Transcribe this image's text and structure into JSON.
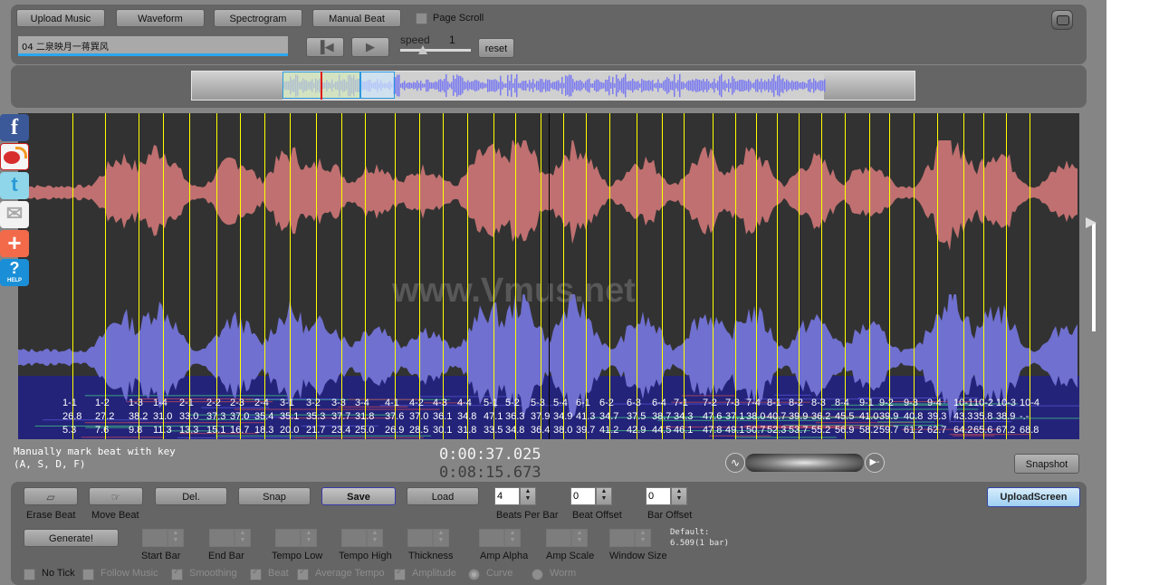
{
  "toolbar": {
    "upload_music": "Upload Music",
    "waveform": "Waveform",
    "spectrogram": "Spectrogram",
    "manual_beat": "Manual Beat",
    "page_scroll": "Page Scroll",
    "page_scroll_checked": false,
    "track_name": "04 二泉映月一蒋巽风",
    "speed_label": "speed",
    "speed_value": "1",
    "reset": "reset"
  },
  "overview": {
    "waveform_color": "#7b7bf0",
    "selection_color": "#d6f0b8",
    "view_color": "#cfe8fb",
    "playhead_color": "#e01010"
  },
  "main_view": {
    "watermark": "www.Vmus.net",
    "beat_line_color": "#ffff00",
    "top_wave_color": "#c07070",
    "bottom_wave_color": "#7070d0",
    "beats": [
      {
        "label": "1-1",
        "tempo": "26.8",
        "time": "5.3"
      },
      {
        "label": "1-2",
        "tempo": "27.2",
        "time": "7.6"
      },
      {
        "label": "1-3",
        "tempo": "38.2",
        "time": "9.8"
      },
      {
        "label": "1-4",
        "tempo": "31.0",
        "time": "11.3"
      },
      {
        "label": "2-1",
        "tempo": "33.0",
        "time": "13.3"
      },
      {
        "label": "2-2",
        "tempo": "37.3",
        "time": "15.1"
      },
      {
        "label": "2-3",
        "tempo": "37.0",
        "time": "16.7"
      },
      {
        "label": "2-4",
        "tempo": "35.4",
        "time": "18.3"
      },
      {
        "label": "3-1",
        "tempo": "35.1",
        "time": "20.0"
      },
      {
        "label": "3-2",
        "tempo": "35.3",
        "time": "21.7"
      },
      {
        "label": "3-3",
        "tempo": "37.7",
        "time": "23.4"
      },
      {
        "label": "3-4",
        "tempo": "31.8",
        "time": "25.0"
      },
      {
        "label": "4-1",
        "tempo": "37.6",
        "time": "26.9"
      },
      {
        "label": "4-2",
        "tempo": "37.0",
        "time": "28.5"
      },
      {
        "label": "4-3",
        "tempo": "36.1",
        "time": "30.1"
      },
      {
        "label": "4-4",
        "tempo": "34.8",
        "time": "31.8"
      },
      {
        "label": "5-1",
        "tempo": "47.1",
        "time": "33.5"
      },
      {
        "label": "5-2",
        "tempo": "36.3",
        "time": "34.8"
      },
      {
        "label": "5-3",
        "tempo": "37.9",
        "time": "36.4"
      },
      {
        "label": "5-4",
        "tempo": "34.9",
        "time": "38.0"
      },
      {
        "label": "6-1",
        "tempo": "41.3",
        "time": "39.7"
      },
      {
        "label": "6-2",
        "tempo": "34.7",
        "time": "41.2"
      },
      {
        "label": "6-3",
        "tempo": "37.5",
        "time": "42.9"
      },
      {
        "label": "6-4",
        "tempo": "38.7",
        "time": "44.5"
      },
      {
        "label": "7-1",
        "tempo": "34.3",
        "time": "46.1"
      },
      {
        "label": "7-2",
        "tempo": "47.6",
        "time": "47.8"
      },
      {
        "label": "7-3",
        "tempo": "37.1",
        "time": "49.1"
      },
      {
        "label": "7-4",
        "tempo": "38.0",
        "time": "50.7"
      },
      {
        "label": "8-1",
        "tempo": "40.7",
        "time": "52.3"
      },
      {
        "label": "8-2",
        "tempo": "39.9",
        "time": "53.7"
      },
      {
        "label": "8-3",
        "tempo": "36.2",
        "time": "55.2"
      },
      {
        "label": "8-4",
        "tempo": "45.5",
        "time": "56.9"
      },
      {
        "label": "9-1",
        "tempo": "41.0",
        "time": "58.2"
      },
      {
        "label": "9-2",
        "tempo": "39.9",
        "time": "59.7"
      },
      {
        "label": "9-3",
        "tempo": "40.8",
        "time": "61.2"
      },
      {
        "label": "9-4",
        "tempo": "39.3",
        "time": "62.7"
      },
      {
        "label": "10-1",
        "tempo": "43.3",
        "time": "64.2"
      },
      {
        "label": "10-2",
        "tempo": "35.8",
        "time": "65.6"
      },
      {
        "label": "10-3",
        "tempo": "38.9",
        "time": "67.2"
      },
      {
        "label": "10-4",
        "tempo": "-.-",
        "time": "68.8"
      }
    ]
  },
  "status": {
    "hint_line1": "Manually mark beat with key",
    "hint_line2": "(A, S, D, F)",
    "current_time": "0:00:37.025",
    "total_time": "0:08:15.673",
    "snapshot": "Snapshot"
  },
  "social": [
    "facebook",
    "weibo",
    "twitter",
    "email",
    "share-plus",
    "help"
  ],
  "help_label": "HELP",
  "controls": {
    "erase_beat": "Erase Beat",
    "move_beat": "Move Beat",
    "del": "Del.",
    "snap": "Snap",
    "save": "Save",
    "load": "Load",
    "beats_per_bar_value": "4",
    "beats_per_bar_label": "Beats Per Bar",
    "beat_offset_value": "0",
    "beat_offset_label": "Beat Offset",
    "bar_offset_value": "0",
    "bar_offset_label": "Bar Offset",
    "upload_screen": "UploadScreen",
    "generate": "Generate!",
    "start_bar": "Start Bar",
    "end_bar": "End Bar",
    "tempo_low": "Tempo Low",
    "tempo_high": "Tempo High",
    "thickness": "Thickness",
    "amp_alpha": "Amp Alpha",
    "amp_scale": "Amp Scale",
    "window_size": "Window Size",
    "default_line1": "Default:",
    "default_line2": "6.509(1 bar)",
    "options": [
      {
        "label": "No Tick",
        "type": "checkbox",
        "checked": false,
        "enabled": true
      },
      {
        "label": "Follow Music",
        "type": "checkbox",
        "checked": false,
        "enabled": false
      },
      {
        "label": "Smoothing",
        "type": "checkbox",
        "checked": true,
        "enabled": false
      },
      {
        "label": "Beat",
        "type": "checkbox",
        "checked": true,
        "enabled": false
      },
      {
        "label": "Average Tempo",
        "type": "checkbox",
        "checked": true,
        "enabled": false
      },
      {
        "label": "Amplitude",
        "type": "checkbox",
        "checked": true,
        "enabled": false
      },
      {
        "label": "Curve",
        "type": "radio",
        "checked": true,
        "enabled": false
      },
      {
        "label": "Worm",
        "type": "radio",
        "checked": false,
        "enabled": false
      }
    ]
  }
}
